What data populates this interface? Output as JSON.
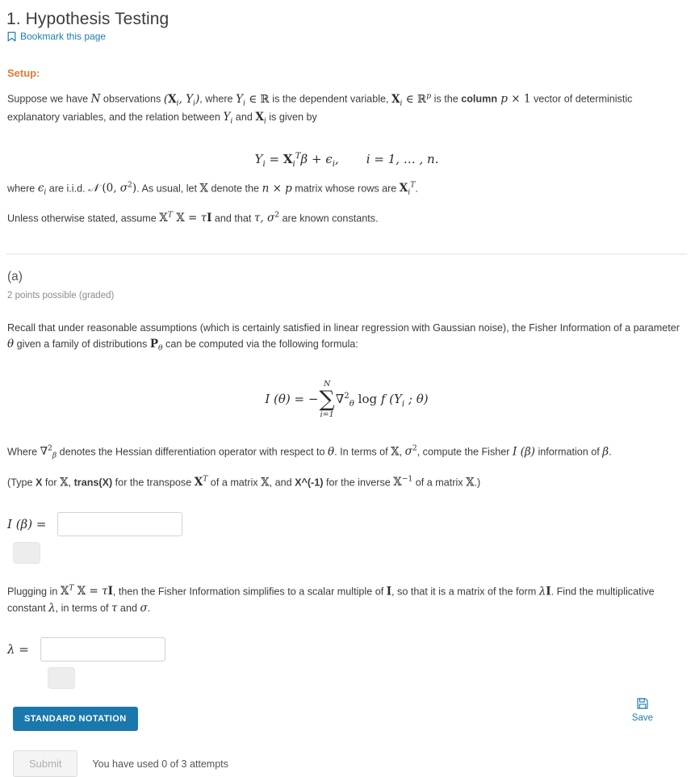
{
  "header": {
    "title": "1. Hypothesis Testing",
    "bookmark_label": "Bookmark this page",
    "bookmark_icon": "bookmark-icon",
    "link_color": "#1e7ca8"
  },
  "setup": {
    "heading": "Setup:",
    "heading_color": "#e07b39",
    "paragraph1_part1": "Suppose we have ",
    "paragraph1_math_N": "N",
    "paragraph1_part2": " observations ",
    "paragraph1_math_obs": "(X_i, Y_i)",
    "paragraph1_part3": ", where ",
    "paragraph1_math_Y": "Y_i ∈ ℝ",
    "paragraph1_part4": " is the dependent variable, ",
    "paragraph1_math_X": "X_i ∈ ℝ^p",
    "paragraph1_part5": " is the ",
    "paragraph1_bold": "column",
    "paragraph1_math_px1": "p × 1",
    "paragraph1_part6": " vector of deterministic explanatory variables, and the relation between ",
    "paragraph1_math_Yi": "Y_i",
    "paragraph1_part7": " and ",
    "paragraph1_math_Xi": "X_i",
    "paragraph1_part8": " is given by",
    "equation": "Y_i = X_i^T β + ϵ_i,    i = 1, … , n.",
    "paragraph2_part1": "where ",
    "paragraph2_math_eps": "ϵ_i",
    "paragraph2_part2": " are i.i.d. ",
    "paragraph2_math_normal": "𝒩 (0, σ²)",
    "paragraph2_part3": ". As usual, let ",
    "paragraph2_math_XX": "𝕏",
    "paragraph2_part4": " denote the ",
    "paragraph2_math_np": "n × p",
    "paragraph2_part5": " matrix whose rows are ",
    "paragraph2_math_rows": "X_i^T",
    "paragraph2_part6": ".",
    "paragraph3_part1": "Unless otherwise stated, assume ",
    "paragraph3_math_gram": "𝕏^T 𝕏 = τ I",
    "paragraph3_part2": " and that ",
    "paragraph3_math_consts": "τ, σ²",
    "paragraph3_part3": " are known constants."
  },
  "part_a": {
    "label": "(a)",
    "points": "2 points possible (graded)",
    "prompt_part1": "Recall that under reasonable assumptions (which is certainly satisfied in linear regression with Gaussian noise), the Fisher Information of a parameter ",
    "prompt_math_theta": "θ",
    "prompt_part2": " given a family of distributions ",
    "prompt_math_P": "P_θ",
    "prompt_part3": " can be computed via the following formula:",
    "formula_lhs": "I (θ) = −",
    "formula_sum_top": "N",
    "formula_sum_bottom": "i=1",
    "formula_rhs": "∇²_θ log f (Y_i ; θ)",
    "where_part1": "Where ",
    "where_math_hessian": "∇²_β",
    "where_part2": " denotes the Hessian differentiation operator with respect to ",
    "where_math_theta": "θ",
    "where_part3": ". In terms of ",
    "where_math_XX": "𝕏",
    "where_part4": ", ",
    "where_math_sigma": "σ²",
    "where_part5": ", compute the Fisher ",
    "where_math_I": "I (β)",
    "where_part6": " information of ",
    "where_math_beta": "β",
    "where_part7": ".",
    "typehint_part1": "(Type ",
    "typehint_bold1": "X",
    "typehint_part2": " for ",
    "typehint_math1": "𝕏",
    "typehint_part3": ", ",
    "typehint_bold2": "trans(X)",
    "typehint_part4": " for the transpose ",
    "typehint_math2": "X^T",
    "typehint_part5": " of a matrix ",
    "typehint_math3": "𝕏",
    "typehint_part6": ", and ",
    "typehint_bold3": "X^(-1)",
    "typehint_part7": " for the inverse ",
    "typehint_math4": "𝕏⁻¹",
    "typehint_part8": " of a matrix ",
    "typehint_math5": "𝕏",
    "typehint_part9": ".)",
    "answer1_label": "I (β) =",
    "answer1_value": "",
    "answer1_placeholder": "",
    "plugging_part1": "Plugging in ",
    "plugging_math_gram": "𝕏^T 𝕏 = τ I",
    "plugging_part2": ", then the Fisher Information simplifies to a scalar multiple of ",
    "plugging_math_I": "I",
    "plugging_part3": ", so that it is a matrix of the form ",
    "plugging_math_lambdaI": "λ I",
    "plugging_part4": ". Find the multiplicative constant ",
    "plugging_math_lambda": "λ",
    "plugging_part5": ", in terms of ",
    "plugging_math_tau": "τ",
    "plugging_part6": " and ",
    "plugging_math_sigma": "σ",
    "plugging_part7": ".",
    "answer2_label": "λ =",
    "answer2_value": "",
    "answer2_placeholder": "",
    "standard_notation_label": "STANDARD NOTATION",
    "standard_notation_color": "#1a78ad"
  },
  "footer": {
    "submit_label": "Submit",
    "attempts_text": "You have used 0 of 3 attempts",
    "save_label": "Save",
    "save_icon": "floppy-disk-save-icon",
    "save_color": "#1e7ca8"
  }
}
